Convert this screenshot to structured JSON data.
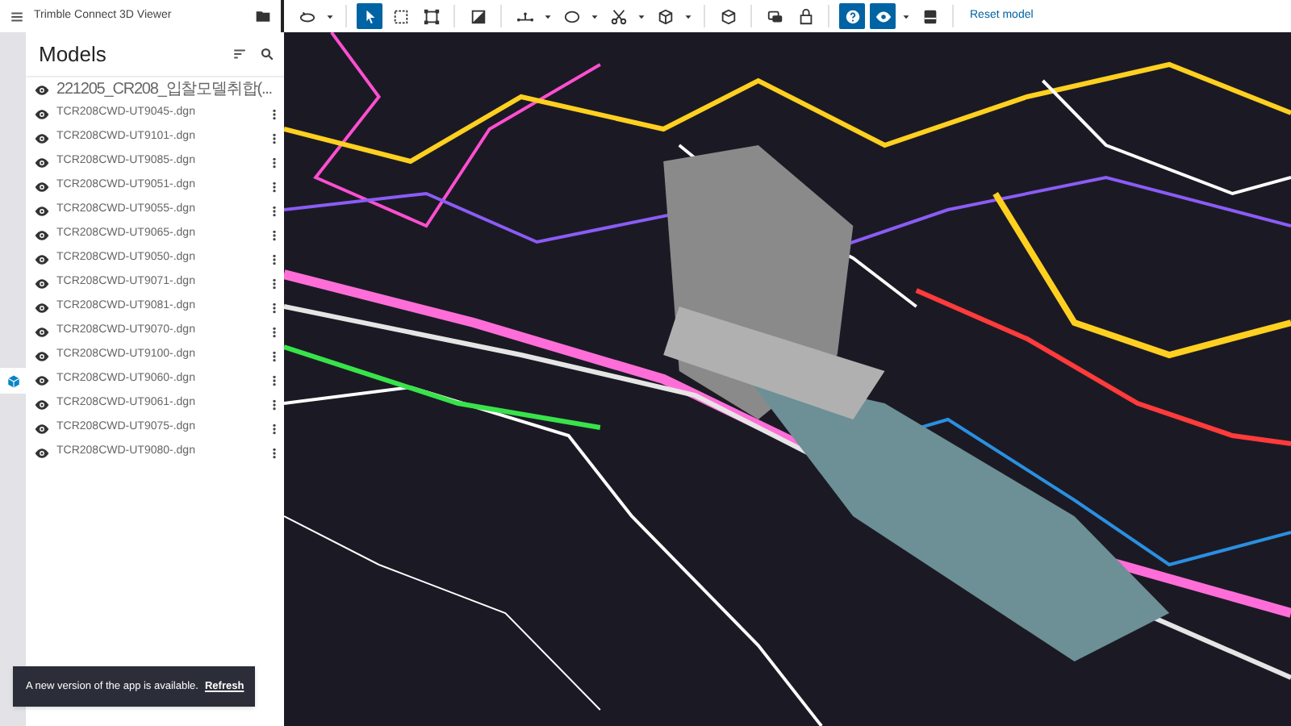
{
  "app_bar": {
    "title": "Trimble Connect 3D Viewer"
  },
  "toolbar": {
    "tools": [
      {
        "selected": false,
        "has_menu": true
      },
      {
        "selected": true,
        "has_menu": false
      },
      {
        "selected": false,
        "has_menu": false
      },
      {
        "selected": false,
        "has_menu": false
      },
      {
        "selected": false,
        "has_menu": false
      },
      {
        "selected": false,
        "has_menu": true
      },
      {
        "selected": false,
        "has_menu": true
      },
      {
        "selected": false,
        "has_menu": true
      },
      {
        "selected": false,
        "has_menu": true
      },
      {
        "selected": false,
        "has_menu": false
      },
      {
        "selected": false,
        "has_menu": false
      },
      {
        "selected": false,
        "has_menu": false
      },
      {
        "selected": true,
        "has_menu": false
      },
      {
        "selected": true,
        "has_menu": true
      },
      {
        "selected": false,
        "has_menu": false
      }
    ],
    "reset_link": "Reset model"
  },
  "side_rail": {
    "models_tab_selected": true
  },
  "models_panel": {
    "title": "Models",
    "items": [
      {
        "name": "221205_CR208_입찰모델취합(...",
        "visible": true
      },
      {
        "name": "TCR208CWD-UT9045-.dgn",
        "visible": true
      },
      {
        "name": "TCR208CWD-UT9101-.dgn",
        "visible": true
      },
      {
        "name": "TCR208CWD-UT9085-.dgn",
        "visible": true
      },
      {
        "name": "TCR208CWD-UT9051-.dgn",
        "visible": true
      },
      {
        "name": "TCR208CWD-UT9055-.dgn",
        "visible": true
      },
      {
        "name": "TCR208CWD-UT9065-.dgn",
        "visible": true
      },
      {
        "name": "TCR208CWD-UT9050-.dgn",
        "visible": true
      },
      {
        "name": "TCR208CWD-UT9071-.dgn",
        "visible": true
      },
      {
        "name": "TCR208CWD-UT9081-.dgn",
        "visible": true
      },
      {
        "name": "TCR208CWD-UT9070-.dgn",
        "visible": true
      },
      {
        "name": "TCR208CWD-UT9100-.dgn",
        "visible": true
      },
      {
        "name": "TCR208CWD-UT9060-.dgn",
        "visible": true
      },
      {
        "name": "TCR208CWD-UT9061-.dgn",
        "visible": true
      },
      {
        "name": "TCR208CWD-UT9075-.dgn",
        "visible": true
      },
      {
        "name": "TCR208CWD-UT9080-.dgn",
        "visible": true
      }
    ]
  },
  "toast": {
    "message": "A new version of the app is available.",
    "action": "Refresh"
  }
}
